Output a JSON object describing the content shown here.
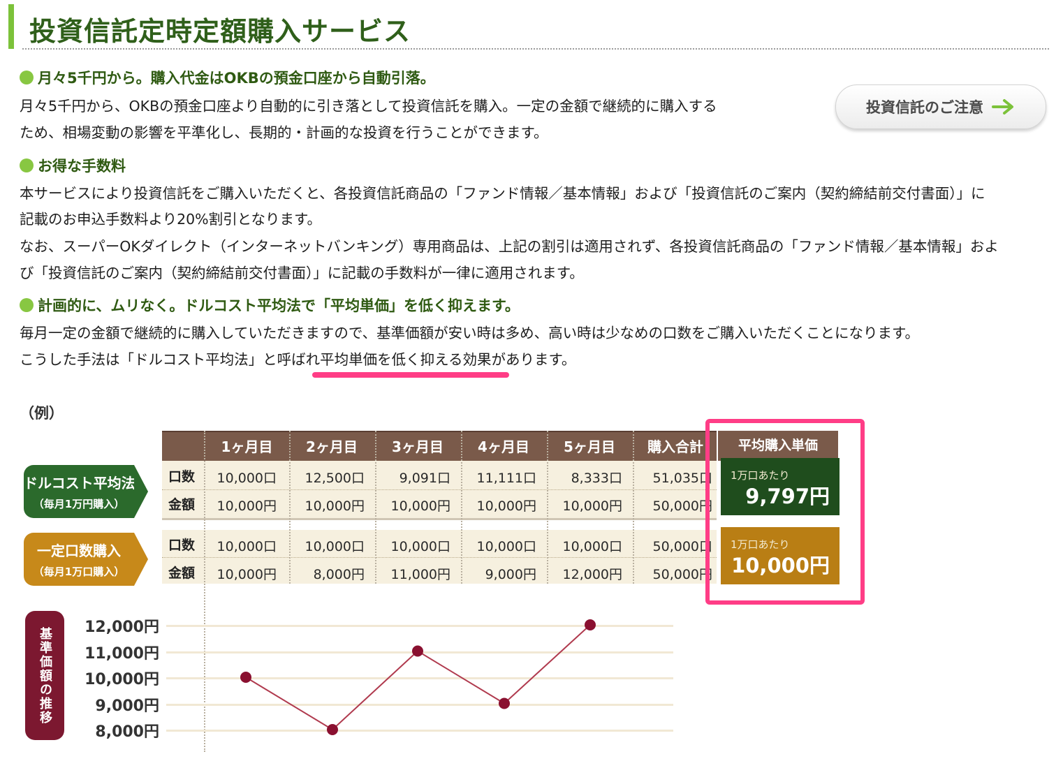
{
  "page": {
    "title": "投資信託定時定額購入サービス",
    "notice_button": "投資信託のご注意",
    "sections": [
      {
        "heading": "月々5千円から。購入代金はOKBの預金口座から自動引落。",
        "lines": [
          "月々5千円から、OKBの預金口座より自動的に引き落として投資信託を購入。一定の金額で継続的に購入する",
          "ため、相場変動の影響を平準化し、長期的・計画的な投資を行うことができます。"
        ]
      },
      {
        "heading": "お得な手数料",
        "lines": [
          "本サービスにより投資信託をご購入いただくと、各投資信託商品の「ファンド情報／基本情報」および「投資信託のご案内（契約締結前交付書面）」に",
          "記載のお申込手数料より20%割引となります。",
          "なお、スーパーOKダイレクト（インターネットバンキング）専用商品は、上記の割引は適用されず、各投資信託商品の「ファンド情報／基本情報」およ",
          "び「投資信託のご案内（契約締結前交付書面）」に記載の手数料が一律に適用されます。"
        ]
      },
      {
        "heading": "計画的に、ムリなく。ドルコスト平均法で「平均単価」を低く抑えます。",
        "lines": [
          "毎月一定の金額で継続的に購入していただきますので、基準価額が安い時は多め、高い時は少なめの口数をご購入いただくことになります。",
          "こうした手法は「ドルコスト平均法」と呼ばれ平均単価を低く抑える効果があります。"
        ]
      }
    ],
    "example_label": "（例）"
  },
  "table": {
    "headers": [
      "1ヶ月目",
      "2ヶ月目",
      "3ヶ月目",
      "4ヶ月目",
      "5ヶ月目",
      "購入合計"
    ],
    "avg_header": "平均購入単価",
    "groups": [
      {
        "name": "ドルコスト平均法",
        "sub": "（毎月1万円購入）",
        "color": "#2b6a2c",
        "rows": [
          {
            "label": "口数",
            "values": [
              "10,000口",
              "12,500口",
              "9,091口",
              "11,111口",
              "8,333口",
              "51,035口"
            ]
          },
          {
            "label": "金額",
            "values": [
              "10,000円",
              "10,000円",
              "10,000円",
              "10,000円",
              "10,000円",
              "50,000円"
            ]
          }
        ],
        "avg_per": "1万口あたり",
        "avg_value": "9,797円",
        "avg_color": "#1f4d1d"
      },
      {
        "name": "一定口数購入",
        "sub": "（毎月1万口購入）",
        "color": "#c7891a",
        "rows": [
          {
            "label": "口数",
            "values": [
              "10,000口",
              "10,000口",
              "10,000口",
              "10,000口",
              "10,000口",
              "50,000口"
            ]
          },
          {
            "label": "金額",
            "values": [
              "10,000円",
              "8,000円",
              "11,000円",
              "9,000円",
              "12,000円",
              "50,000円"
            ]
          }
        ],
        "avg_per": "1万口あたり",
        "avg_value": "10,000円",
        "avg_color": "#b97e14"
      }
    ]
  },
  "chart_data": {
    "type": "line",
    "title": "",
    "ylabel": "基準価額の推移",
    "xlabel": "",
    "categories": [
      "1ヶ月目",
      "2ヶ月目",
      "3ヶ月目",
      "4ヶ月目",
      "5ヶ月目"
    ],
    "values": [
      10000,
      8000,
      11000,
      9000,
      12000
    ],
    "ylim": [
      8000,
      12000
    ],
    "yticks": [
      "12,000円",
      "11,000円",
      "10,000円",
      "9,000円",
      "8,000円"
    ],
    "line_color": "#b03a4e",
    "marker_color": "#8a1030",
    "grid": true
  }
}
